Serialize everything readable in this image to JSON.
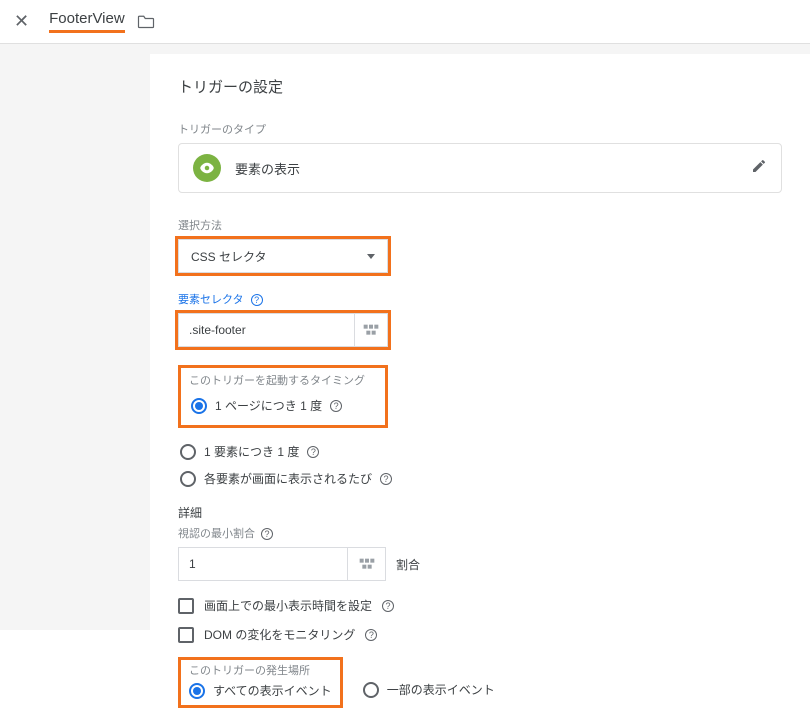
{
  "header": {
    "title": "FooterView"
  },
  "section_title": "トリガーの設定",
  "trigger_type": {
    "label": "トリガーのタイプ",
    "value": "要素の表示"
  },
  "select_method": {
    "label": "選択方法",
    "value": "CSS セレクタ"
  },
  "element_selector": {
    "label": "要素セレクタ",
    "value": ".site-footer"
  },
  "timing": {
    "label": "このトリガーを起動するタイミング",
    "options": [
      {
        "label": "1 ページにつき 1 度",
        "checked": true,
        "help": true
      },
      {
        "label": "1 要素につき 1 度",
        "checked": false,
        "help": true
      },
      {
        "label": "各要素が画面に表示されるたび",
        "checked": false,
        "help": true
      }
    ]
  },
  "details": {
    "heading": "詳細",
    "min_pct_label": "視認の最小割合",
    "min_pct_value": "1",
    "min_pct_suffix": "割合",
    "checkboxes": [
      {
        "label": "画面上での最小表示時間を設定",
        "checked": false,
        "help": true
      },
      {
        "label": "DOM の変化をモニタリング",
        "checked": false,
        "help": true
      }
    ]
  },
  "fire": {
    "label": "このトリガーの発生場所",
    "options": [
      {
        "label": "すべての表示イベント",
        "checked": true
      },
      {
        "label": "一部の表示イベント",
        "checked": false
      }
    ]
  },
  "help_glyph": "?"
}
